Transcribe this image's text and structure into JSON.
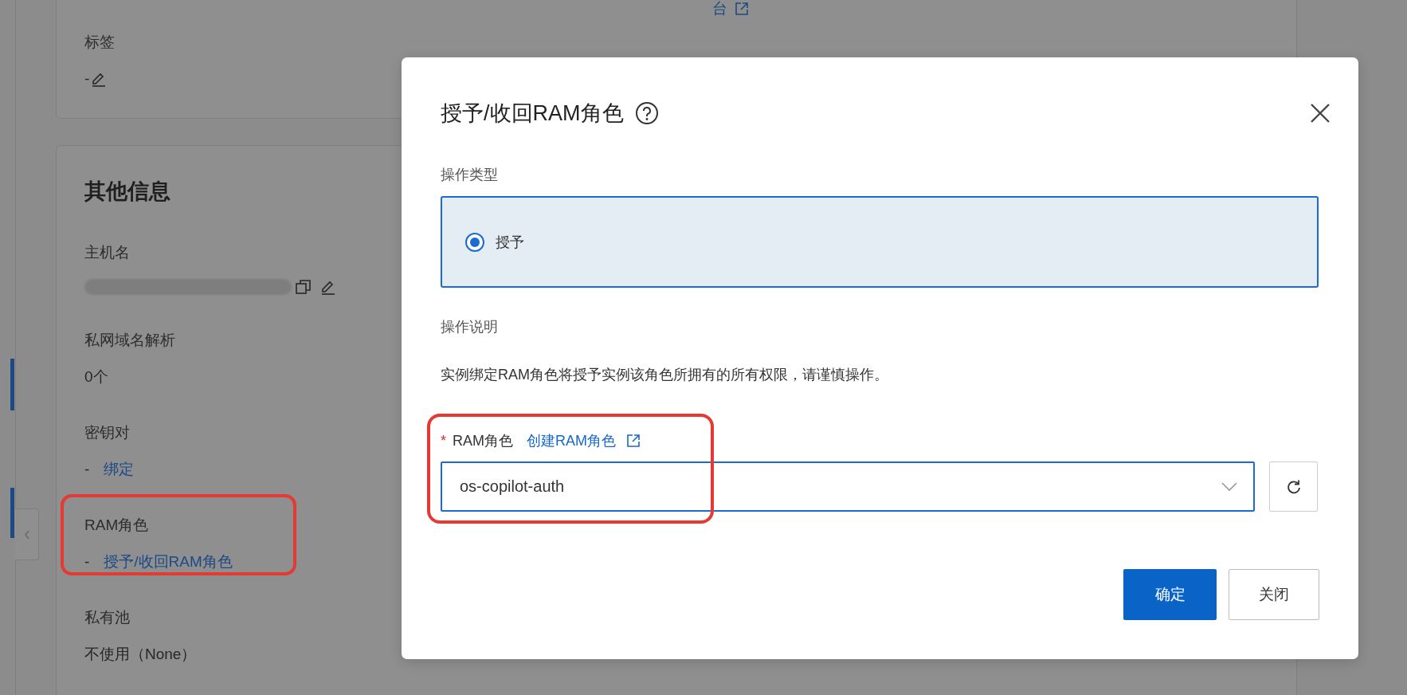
{
  "background_page": {
    "top_link": "台",
    "tags": {
      "label": "标签",
      "value": "-"
    },
    "section_title": "其他信息",
    "fields": [
      {
        "kind": "redacted",
        "label": "主机名"
      },
      {
        "kind": "text",
        "label": "私网域名解析",
        "value": "0个"
      },
      {
        "kind": "link",
        "label": "密钥对",
        "value": "-",
        "link": "绑定"
      },
      {
        "kind": "link",
        "label": "RAM角色",
        "value": "-",
        "link": "授予/收回RAM角色",
        "highlighted": true
      },
      {
        "kind": "text",
        "label": "私有池",
        "value": "不使用（None）"
      }
    ]
  },
  "dialog": {
    "title": "授予/收回RAM角色",
    "operation_type": {
      "label": "操作类型",
      "options": [
        {
          "label": "授予",
          "selected": true
        }
      ]
    },
    "description": {
      "label": "操作说明",
      "text": "实例绑定RAM角色将授予实例该角色所拥有的所有权限，请谨慎操作。"
    },
    "ram_role": {
      "required": true,
      "required_mark": "*",
      "label": "RAM角色",
      "link": "创建RAM角色",
      "value": "os-copilot-auth",
      "highlighted": true
    },
    "buttons": [
      {
        "label": "确定",
        "kind": "primary"
      },
      {
        "label": "关闭",
        "kind": "default"
      }
    ]
  }
}
